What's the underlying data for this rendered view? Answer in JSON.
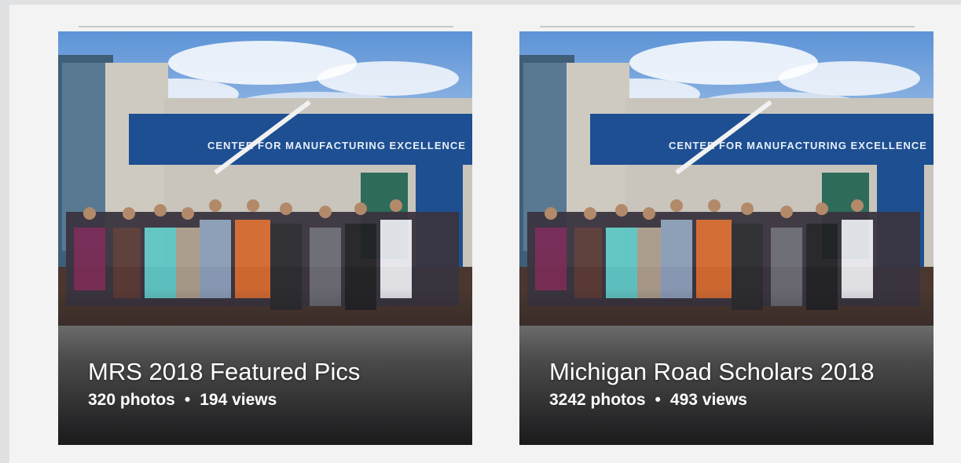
{
  "albums": [
    {
      "title": "MRS 2018 Featured Pics",
      "photos": "320 photos",
      "views": "194 views",
      "separator": "•",
      "banner_text": "CENTER FOR MANUFACTURING EXCELLENCE"
    },
    {
      "title": "Michigan Road Scholars 2018",
      "photos": "3242 photos",
      "views": "493 views",
      "separator": "•",
      "banner_text": "CENTER FOR MANUFACTURING EXCELLENCE"
    }
  ],
  "colors": {
    "sky": "#6f9fd8",
    "building_blue": "#1d4f92",
    "wall": "#c8c4bb",
    "ground": "#4a3730",
    "pavement": "#8f8f8f"
  }
}
